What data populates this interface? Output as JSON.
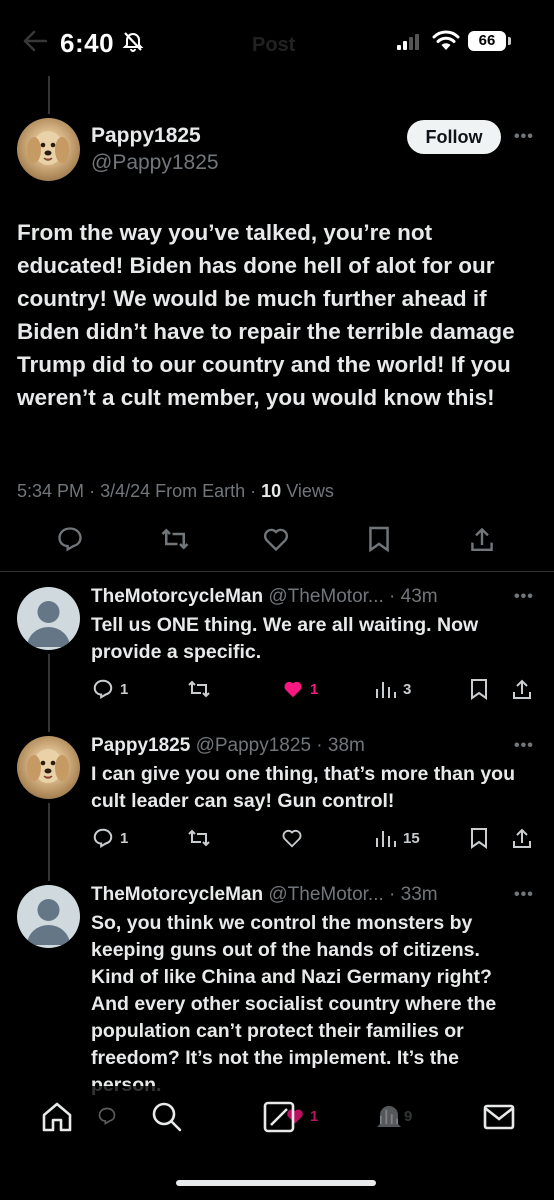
{
  "status_bar": {
    "time": "6:40",
    "battery": "66"
  },
  "header": {
    "title": "Post"
  },
  "main_post": {
    "display_name": "Pappy1825",
    "handle": "@Pappy1825",
    "follow_label": "Follow",
    "text": "From the way you’ve talked, you’re not educated!  Biden has done hell of alot for our country!  We would be much further ahead if Biden didn’t have to repair the terrible damage Trump did to our country and the world!  If you weren’t a cult member, you would know this!",
    "time": "5:34 PM",
    "date": "3/4/24",
    "source": "From Earth",
    "views_count": "10",
    "views_label": "Views"
  },
  "replies": [
    {
      "display_name": "TheMotorcycleMan",
      "handle": "@TheMotor...",
      "age": "· 43m",
      "text": "Tell us ONE thing. We are all waiting. Now provide a specific.",
      "replies": "1",
      "likes": "1",
      "views": "3",
      "liked": true
    },
    {
      "display_name": "Pappy1825",
      "handle": "@Pappy1825",
      "age": "· 38m",
      "text": "I can give you one thing, that’s more than you cult leader can say!  Gun control!",
      "replies": "1",
      "likes": "",
      "views": "15",
      "liked": false
    },
    {
      "display_name": "TheMotorcycleMan",
      "handle": "@TheMotor...",
      "age": "· 33m",
      "text": "So, you think we control the monsters by keeping guns out of the hands of citizens. Kind of like China and Nazi  Germany right? And every other socialist country where the population can’t protect their families or freedom? It’s not the implement. It’s the person.",
      "ghost_likes": "1",
      "ghost_views": "9"
    }
  ],
  "icons": {
    "reply": "reply-icon",
    "retweet": "retweet-icon",
    "like": "heart-icon",
    "bookmark": "bookmark-icon",
    "share": "share-icon",
    "views": "views-icon",
    "home": "home-icon",
    "search": "search-icon",
    "grok": "grok-icon",
    "notifications": "bell-icon",
    "messages": "mail-icon"
  },
  "colors": {
    "background": "#000000",
    "text": "#e7e9ea",
    "muted": "#71767b",
    "like": "#f91880",
    "divider": "#2f3336"
  }
}
